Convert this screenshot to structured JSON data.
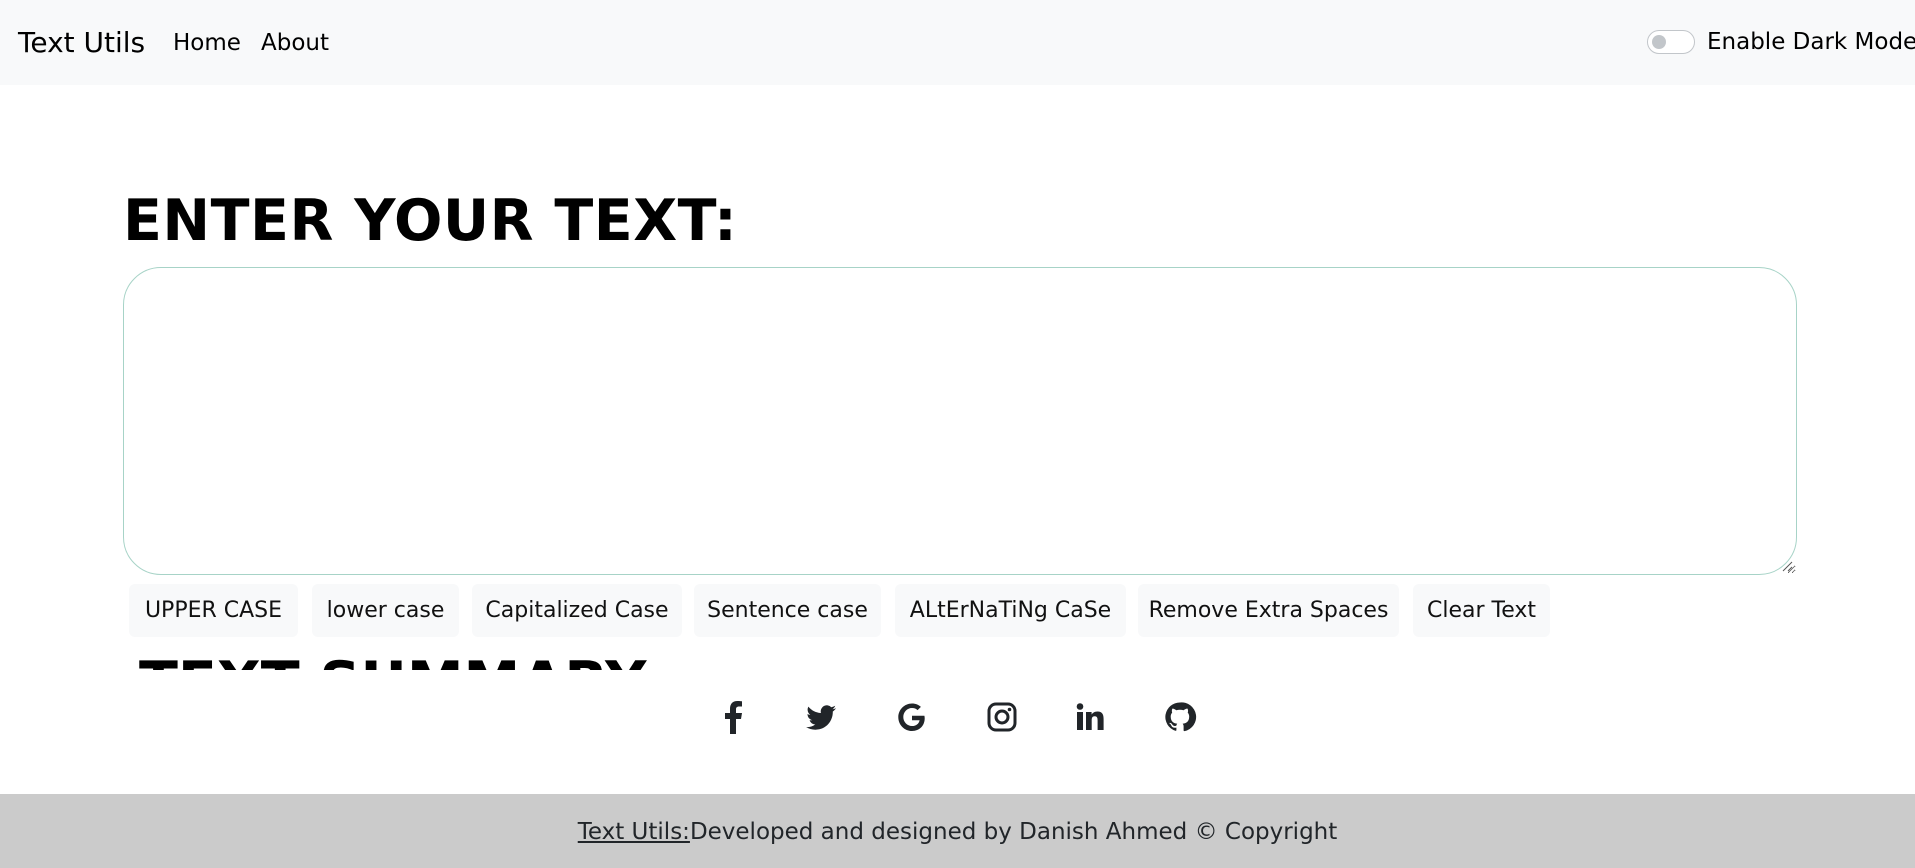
{
  "navbar": {
    "brand": "Text Utils",
    "links": [
      {
        "label": "Home"
      },
      {
        "label": "About"
      }
    ],
    "dark_mode_label": "Enable Dark Mode",
    "dark_mode_enabled": false
  },
  "main": {
    "heading": "ENTER YOUR TEXT:",
    "textarea_value": "",
    "buttons": [
      {
        "label": "UPPER CASE"
      },
      {
        "label": "lower case"
      },
      {
        "label": "Capitalized Case"
      },
      {
        "label": "Sentence case"
      },
      {
        "label": "ALtErNaTiNg CaSe"
      },
      {
        "label": "Remove Extra Spaces"
      },
      {
        "label": "Clear Text"
      }
    ],
    "summary_heading": "TEXT SUMMARY"
  },
  "social": {
    "icons": [
      "facebook-icon",
      "twitter-icon",
      "google-icon",
      "instagram-icon",
      "linkedin-icon",
      "github-icon"
    ],
    "icon_color": "#212529"
  },
  "footer": {
    "link_text": "Text Utils:",
    "text": "Developed and designed by Danish Ahmed © Copyright",
    "background": "#cbcbcb"
  },
  "colors": {
    "navbar_bg": "#f8f9fa",
    "textarea_border": "#a7d3c7",
    "button_bg": "#f8f9fa"
  }
}
